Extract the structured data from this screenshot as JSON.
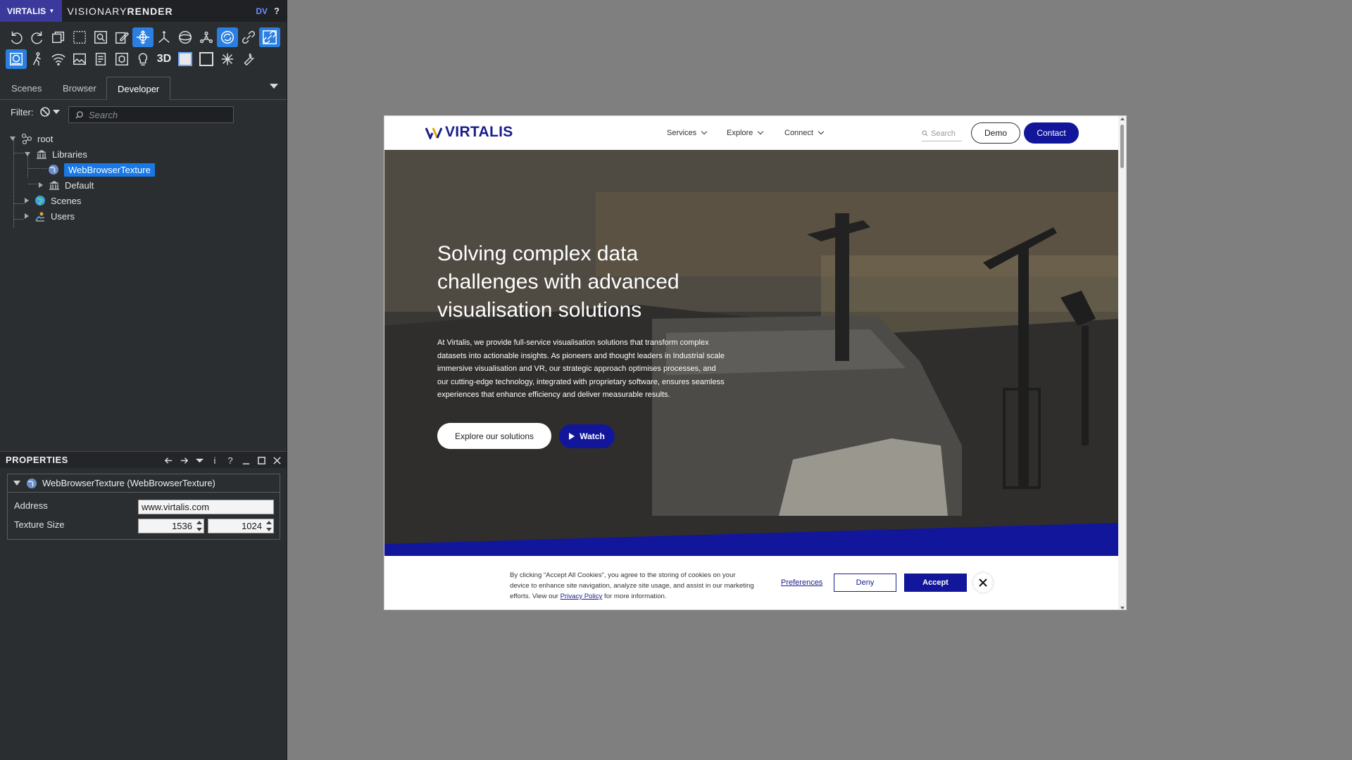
{
  "app": {
    "vendor_button": "VIRTALIS",
    "title_light": "VISIONARY",
    "title_bold": "RENDER",
    "badge": "DV",
    "help": "?"
  },
  "toolbar": {
    "row1": [
      "undo-icon",
      "redo-icon",
      "copy-icon",
      "select-rectangle-icon",
      "zoom-select-icon",
      "edit-pencil-icon",
      "move-gizmo-icon",
      "axis-gizmo-icon",
      "orbit-icon",
      "network-icon",
      "sync-icon",
      "link-icon",
      "link-toggle-icon"
    ],
    "row2": [
      "scene-icon",
      "walk-icon",
      "wifi-icon",
      "image-icon",
      "document-icon",
      "box-icon",
      "bulb-icon",
      "3d-toggle",
      "solid-square-icon",
      "empty-square-icon",
      "gizmo-icon",
      "wrench-icon"
    ],
    "label_3d": "3D"
  },
  "tabs": [
    {
      "label": "Scenes",
      "active": false
    },
    {
      "label": "Browser",
      "active": false
    },
    {
      "label": "Developer",
      "active": true
    }
  ],
  "filter": {
    "label": "Filter:",
    "search_placeholder": "Search"
  },
  "tree": {
    "root": "root",
    "libraries": "Libraries",
    "web_texture": "WebBrowserTexture",
    "default": "Default",
    "scenes": "Scenes",
    "users": "Users"
  },
  "properties": {
    "title": "PROPERTIES",
    "object_label": "WebBrowserTexture (WebBrowserTexture)",
    "address_label": "Address",
    "address_value": "www.virtalis.com",
    "texture_size_label": "Texture Size",
    "texture_width": "1536",
    "texture_height": "1024",
    "tools": [
      "back-icon",
      "forward-icon",
      "dropdown-icon",
      "info-icon",
      "help-icon",
      "minimize-icon",
      "maximize-icon",
      "close-icon"
    ]
  },
  "website": {
    "logo_text": "VIRTALIS",
    "nav": [
      "Services",
      "Explore",
      "Connect"
    ],
    "search_placeholder": "Search",
    "demo_button": "Demo",
    "contact_button": "Contact",
    "hero_title": "Solving complex data challenges with advanced visualisation solutions",
    "hero_body": "At Virtalis, we provide full-service visualisation solutions that transform complex datasets into actionable insights. As pioneers and thought leaders in Industrial scale immersive visualisation and VR, our strategic approach optimises processes, and our cutting-edge technology, integrated with proprietary software, ensures seamless experiences that enhance efficiency and deliver measurable results.",
    "explore_button": "Explore our solutions",
    "watch_button": "Watch",
    "cookie_text_before": "By clicking “Accept All Cookies”, you agree to the storing of cookies on your device to enhance site navigation, analyze site usage, and assist in our marketing efforts. View our ",
    "cookie_link": "Privacy Policy",
    "cookie_text_after": " for more information.",
    "preferences": "Preferences",
    "deny": "Deny",
    "accept": "Accept"
  },
  "colors": {
    "brand_blue": "#12169a",
    "selection_blue": "#1778e6",
    "vendor_purple": "#3b3a9c"
  }
}
